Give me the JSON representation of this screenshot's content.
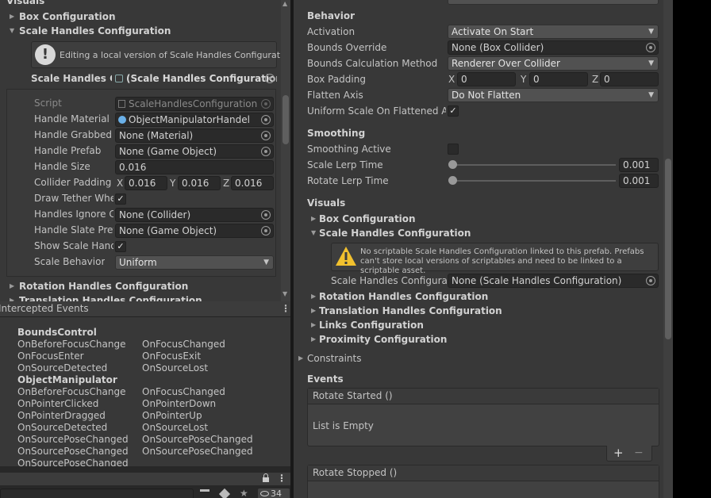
{
  "left_inspector": {
    "section_title": "Visuals",
    "box_config": "Box Configuration",
    "scale_handles_config": "Scale Handles Configuration",
    "info_message": "Editing a local version of Scale Handles Configuration.",
    "scale_handles_field_label": "Scale Handles Co",
    "scale_handles_field_value": "(Scale Handles Configuration",
    "props": {
      "script_label": "Script",
      "script_value": "ScaleHandlesConfiguration",
      "handle_material_label": "Handle Material",
      "handle_material_value": "ObjectManipulatorHandel",
      "handle_grabbed_label": "Handle Grabbed M",
      "handle_grabbed_value": "None (Material)",
      "handle_prefab_label": "Handle Prefab",
      "handle_prefab_value": "None (Game Object)",
      "handle_size_label": "Handle Size",
      "handle_size_value": "0.016",
      "collider_padding_label": "Collider Padding",
      "collider_x": "0.016",
      "collider_y": "0.016",
      "collider_z": "0.016",
      "draw_tether_label": "Draw Tether Whe",
      "ignore_collider_label": "Handles Ignore Co",
      "ignore_collider_value": "None (Collider)",
      "slate_prefab_label": "Handle Slate Pref",
      "slate_prefab_value": "None (Game Object)",
      "show_scale_label": "Show Scale Hand",
      "scale_behavior_label": "Scale Behavior",
      "scale_behavior_value": "Uniform"
    },
    "rotation_handles": "Rotation Handles Configuration",
    "translation_handles": "Translation Handles Configuration"
  },
  "events_panel": {
    "title": "Intercepted Events",
    "groups": [
      {
        "name": "BoundsControl",
        "left": [
          "OnBeforeFocusChange",
          "OnFocusEnter",
          "OnSourceDetected"
        ],
        "right": [
          "OnFocusChanged",
          "OnFocusExit",
          "OnSourceLost"
        ]
      },
      {
        "name": "ObjectManipulator",
        "left": [
          "OnBeforeFocusChange",
          "OnPointerClicked",
          "OnPointerDragged",
          "OnSourceDetected",
          "OnSourcePoseChanged",
          "OnSourcePoseChanged",
          "OnSourcePoseChanged"
        ],
        "right": [
          "OnFocusChanged",
          "OnPointerDown",
          "OnPointerUp",
          "OnSourceLost",
          "OnSourcePoseChanged",
          "OnSourcePoseChanged"
        ]
      }
    ]
  },
  "bottom_toolbar": {
    "visible_count": "34",
    "lock_icon": "lock-icon",
    "more_icon": "kebab-menu-icon"
  },
  "right_inspector": {
    "behavior": {
      "title": "Behavior",
      "activation_label": "Activation",
      "activation_value": "Activate On Start",
      "bounds_override_label": "Bounds Override",
      "bounds_override_value": "None (Box Collider)",
      "bounds_calc_label": "Bounds Calculation Method",
      "bounds_calc_value": "Renderer Over Collider",
      "box_padding_label": "Box Padding",
      "box_padding_x": "0",
      "box_padding_y": "0",
      "box_padding_z": "0",
      "flatten_axis_label": "Flatten Axis",
      "flatten_axis_value": "Do Not Flatten",
      "uniform_scale_label": "Uniform Scale On Flattened Axi"
    },
    "smoothing": {
      "title": "Smoothing",
      "smoothing_active_label": "Smoothing Active",
      "scale_lerp_label": "Scale Lerp Time",
      "scale_lerp_value": "0.001",
      "rotate_lerp_label": "Rotate Lerp Time",
      "rotate_lerp_value": "0.001"
    },
    "visuals": {
      "title": "Visuals",
      "box_config": "Box Configuration",
      "scale_handles_config": "Scale Handles Configuration",
      "warning_text": "No scriptable Scale Handles Configuration linked to this prefab. Prefabs can't store local versions of scriptables and need to be linked to a scriptable asset.",
      "scale_handles_field_label": "Scale Handles Configurati",
      "scale_handles_field_value": "None (Scale Handles Configuration)",
      "rotation_handles": "Rotation Handles Configuration",
      "translation_handles": "Translation Handles Configuration",
      "links_config": "Links Configuration",
      "proximity_config": "Proximity Configuration"
    },
    "constraints": "Constraints",
    "events": {
      "title": "Events",
      "rotate_started": "Rotate Started ()",
      "list_empty": "List is Empty",
      "plus": "+",
      "minus": "−",
      "rotate_stopped": "Rotate Stopped ()"
    }
  },
  "axis_labels": {
    "x": "X",
    "y": "Y",
    "z": "Z"
  },
  "colors": {
    "panel_bg": "#383838",
    "field_bg": "#2a2a2a",
    "dropdown_bg": "#515151",
    "warning_yellow": "#f2c12e"
  }
}
